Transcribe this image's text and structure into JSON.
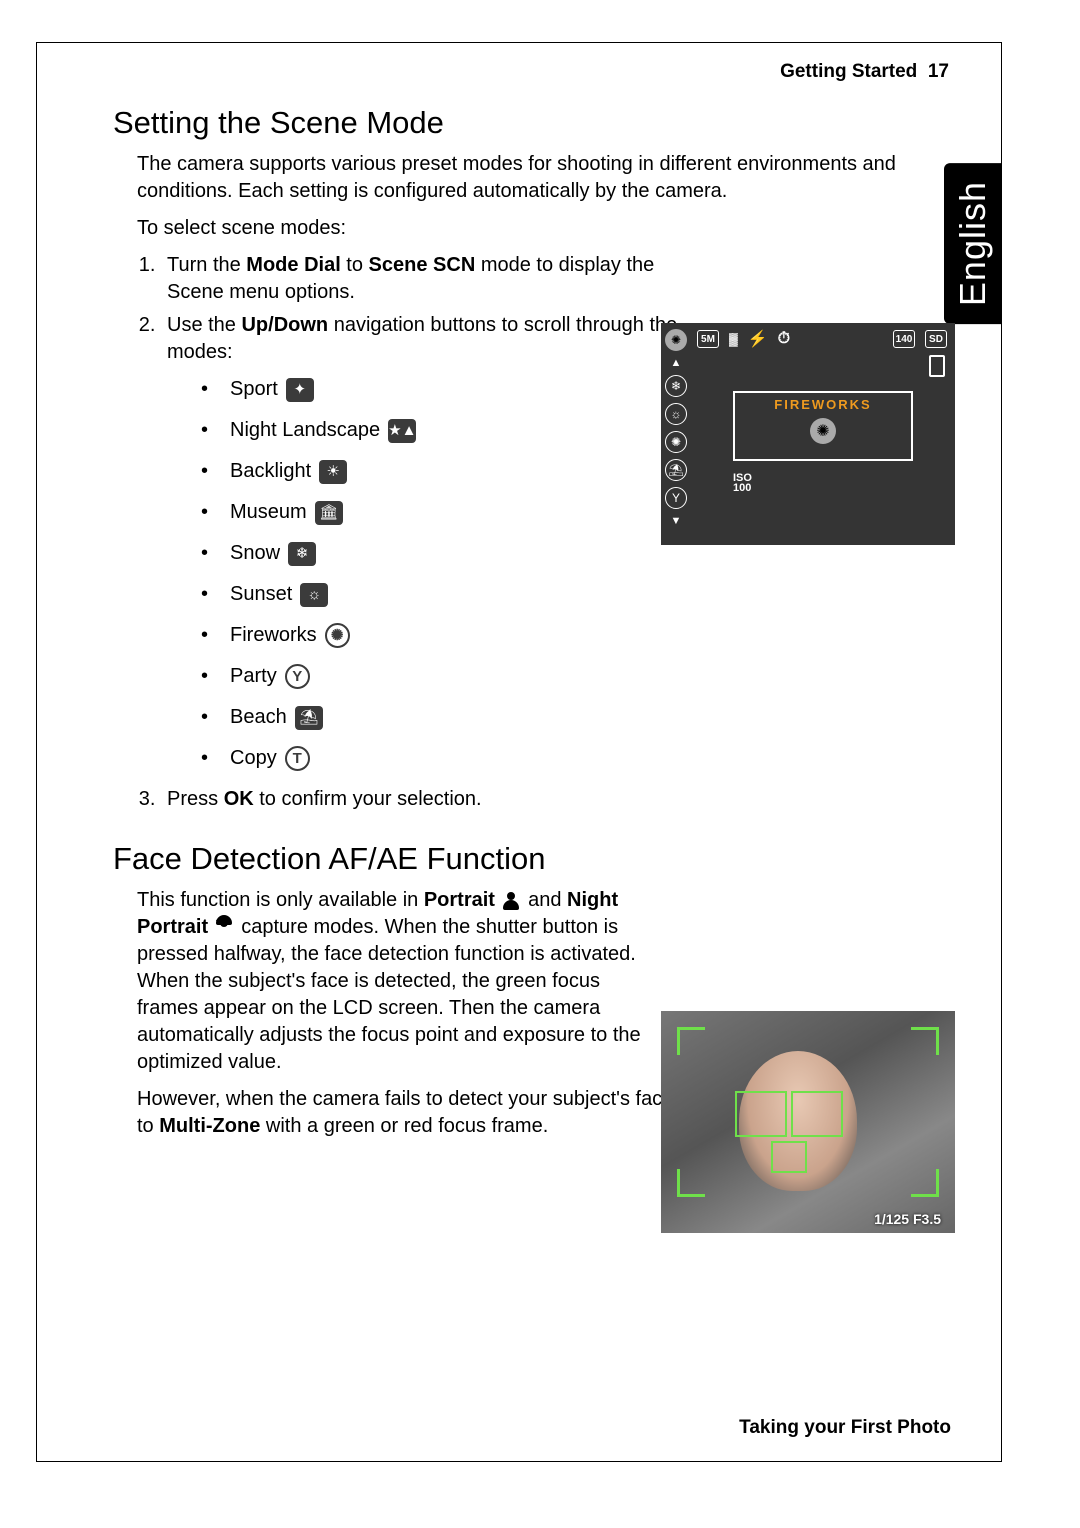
{
  "header": {
    "section": "Getting Started",
    "page": "17"
  },
  "language_tab": "English",
  "section1": {
    "title": "Setting the Scene Mode",
    "intro": "The camera supports various preset modes for shooting in different environments and conditions. Each setting is configured automatically by the camera.",
    "sub": "To select scene modes:",
    "step1_a": "Turn the ",
    "step1_b": "Mode Dial",
    "step1_c": " to ",
    "step1_d": "Scene",
    "step1_scn": "SCN",
    "step1_e": " mode to display the Scene menu options.",
    "step2_a": "Use the ",
    "step2_b": "Up/Down",
    "step2_c": " navigation buttons to scroll through the modes:",
    "modes": [
      "Sport",
      "Night Landscape",
      "Backlight",
      "Museum",
      "Snow",
      "Sunset",
      "Fireworks",
      "Party",
      "Beach",
      "Copy"
    ],
    "mode_icons": [
      "✦",
      "★▲",
      "☀",
      "🏛",
      "❄",
      "☼",
      "✺",
      "Y",
      "⛱",
      "T"
    ],
    "step3_a": "Press ",
    "step3_b": "OK",
    "step3_c": " to confirm your selection."
  },
  "section2": {
    "title": "Face Detection AF/AE Function",
    "p1_a": "This function is only available in ",
    "p1_b": "Portrait",
    "p1_c": " and ",
    "p1_d": "Night Portrait",
    "p1_e": " capture modes. When the shutter button is pressed halfway, the face detection function is activated. When the subject's face is detected, the green focus frames appear on the LCD screen. Then the camera automatically adjusts the focus point and exposure to the optimized value.",
    "p2_a": "However, when the camera fails to detect your subject's face, the camera will set the focus to ",
    "p2_b": "Multi-Zone",
    "p2_c": " with a green or red focus frame."
  },
  "lcd1": {
    "top_5m": "5M",
    "top_140": "140",
    "top_sd": "SD",
    "label": "FIREWORKS",
    "iso_top": "ISO",
    "iso_bot": "100"
  },
  "lcd2": {
    "exposure": "1/125  F3.5"
  },
  "footer": "Taking your First Photo"
}
